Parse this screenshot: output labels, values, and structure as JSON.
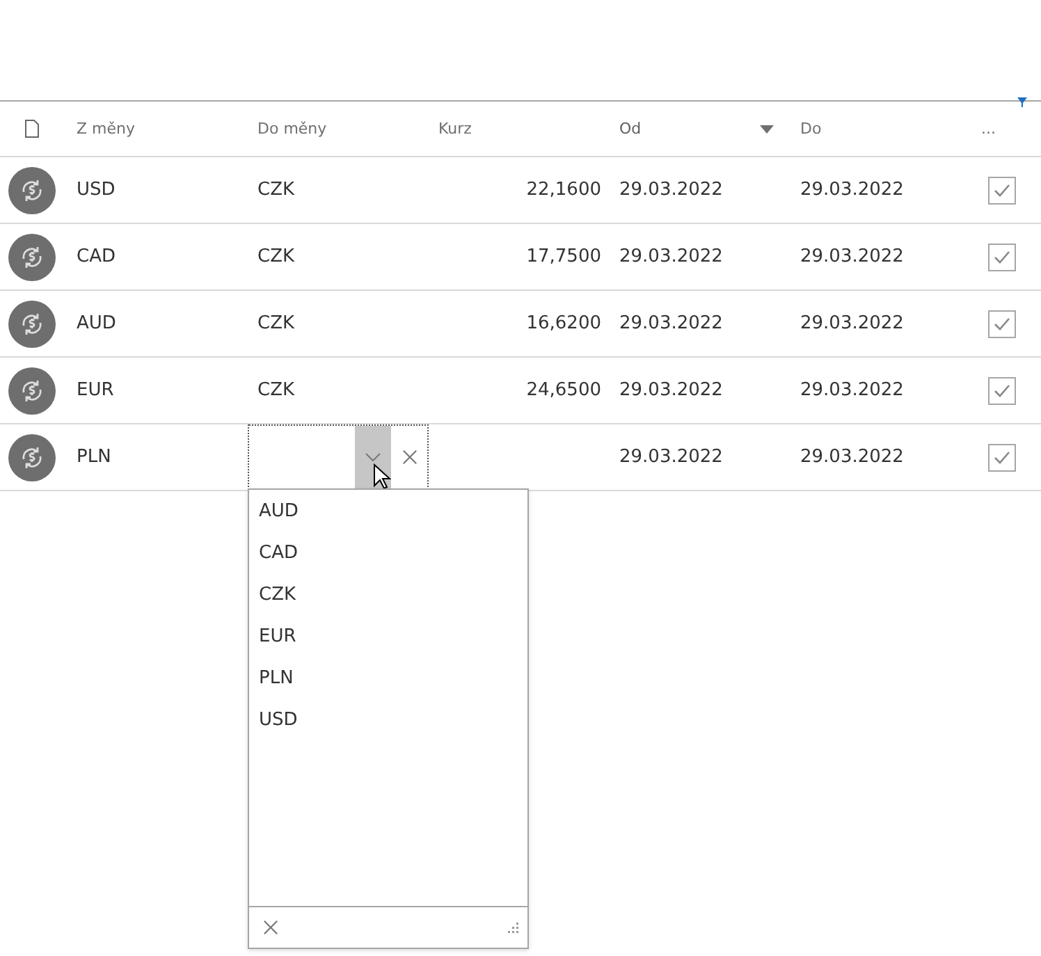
{
  "table": {
    "columns": [
      {
        "label": "Z měny",
        "sorted": false
      },
      {
        "label": "Do měny",
        "sorted": false
      },
      {
        "label": "Kurz",
        "sorted": false
      },
      {
        "label": "Od",
        "sorted": true
      },
      {
        "label": "Do",
        "sorted": false
      },
      {
        "label": "...",
        "sorted": false,
        "filtered": true
      }
    ],
    "rows": [
      {
        "from": "USD",
        "to": "CZK",
        "rate": "22,1600",
        "start": "29.03.2022",
        "end": "29.03.2022",
        "checked": true,
        "editing": false
      },
      {
        "from": "CAD",
        "to": "CZK",
        "rate": "17,7500",
        "start": "29.03.2022",
        "end": "29.03.2022",
        "checked": true,
        "editing": false
      },
      {
        "from": "AUD",
        "to": "CZK",
        "rate": "16,6200",
        "start": "29.03.2022",
        "end": "29.03.2022",
        "checked": true,
        "editing": false
      },
      {
        "from": "EUR",
        "to": "CZK",
        "rate": "24,6500",
        "start": "29.03.2022",
        "end": "29.03.2022",
        "checked": true,
        "editing": false
      },
      {
        "from": "PLN",
        "to": "",
        "rate": "",
        "start": "29.03.2022",
        "end": "29.03.2022",
        "checked": true,
        "editing": true
      }
    ]
  },
  "dropdown": {
    "options": [
      "AUD",
      "CAD",
      "CZK",
      "EUR",
      "PLN",
      "USD"
    ]
  }
}
